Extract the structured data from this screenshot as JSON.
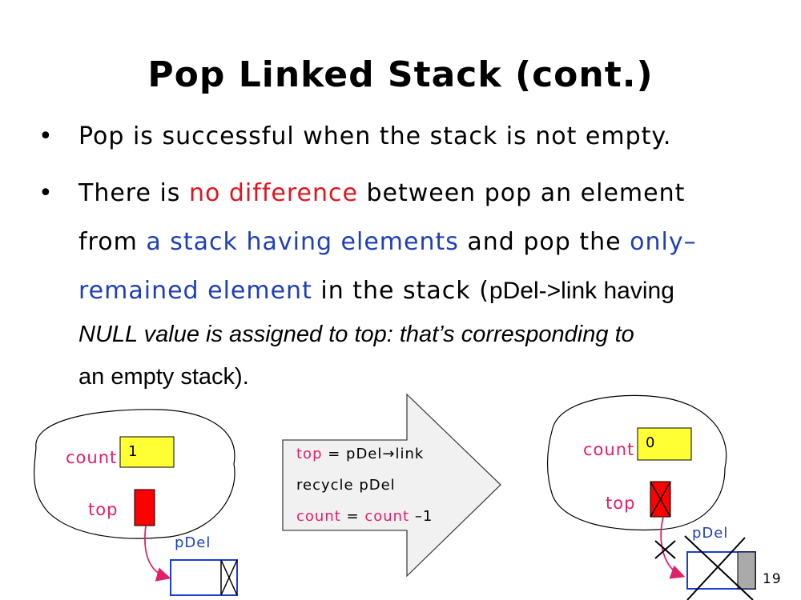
{
  "slide": {
    "title": "Pop Linked Stack (cont.)",
    "page_number": "19"
  },
  "bullets": {
    "b1": "Pop is successful when the stack is not empty.",
    "b2_a": "There is ",
    "b2_b": "no difference",
    "b2_c": " between pop an element",
    "b2_d": "from ",
    "b2_e": "a stack having elements",
    "b2_f": " and pop the ",
    "b2_g": "only–",
    "b2_h": "remained element",
    "b2_i": " in the stack (",
    "b2_j": "pDel->link having",
    "b2_k": "NULL value is assigned to top: that’s corresponding to",
    "b2_l": "an empty stack",
    "b2_m": ")."
  },
  "left_diagram": {
    "count_label": "count",
    "count_value": "1",
    "top_label": "top",
    "pdel_label": "pDel"
  },
  "arrow_text": {
    "line1_a": "top",
    "line1_b": " = pDel→link",
    "line2": "recycle pDel",
    "line3_a": "count",
    "line3_b": " = ",
    "line3_c": "count",
    "line3_d": " –1"
  },
  "right_diagram": {
    "count_label": "count",
    "count_value": "0",
    "top_label": "top",
    "pdel_label": "pDel"
  },
  "colors": {
    "red": "#e0151f",
    "blue": "#1f3fb8",
    "pink": "#e0206a",
    "yellow": "#ffff33"
  }
}
